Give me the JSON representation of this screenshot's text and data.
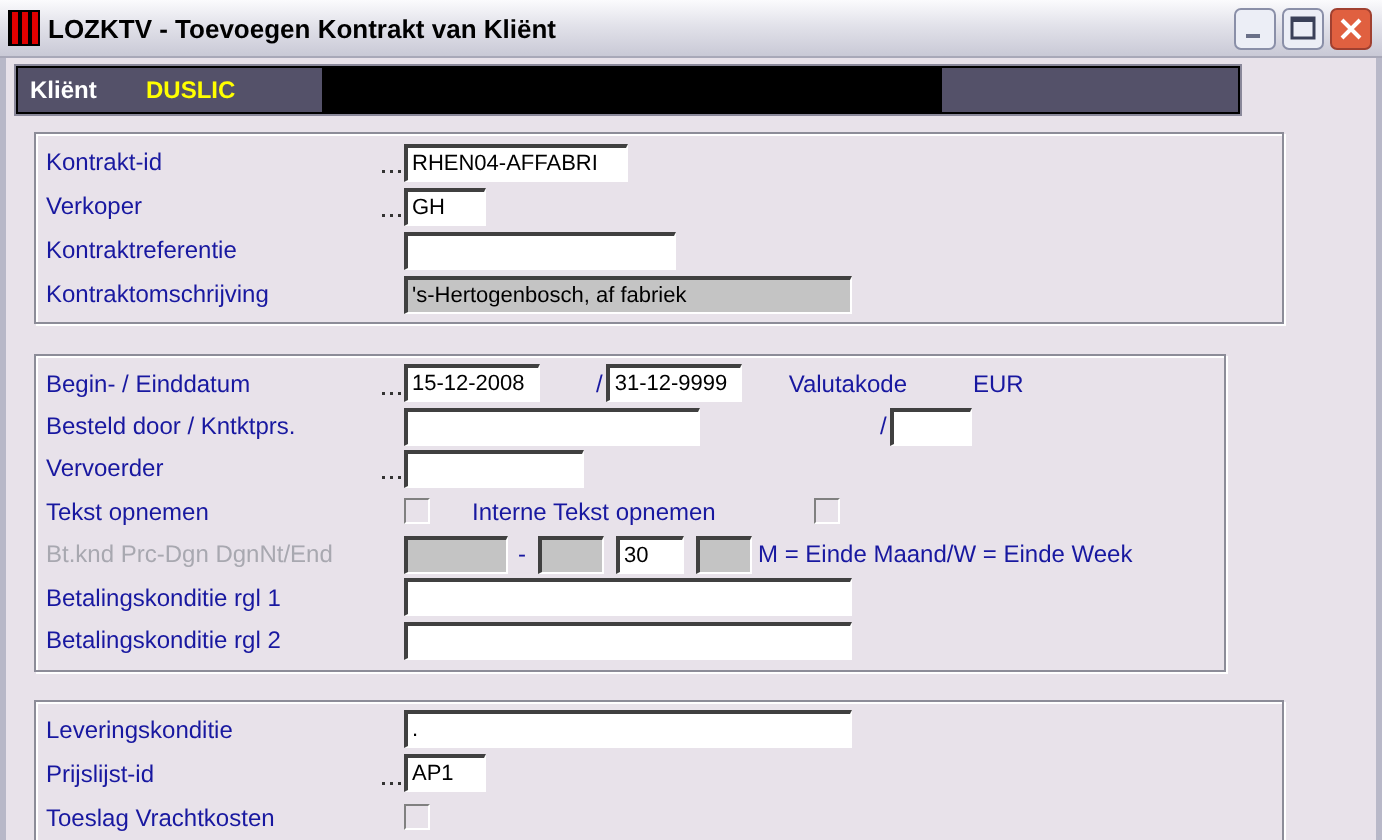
{
  "window": {
    "title": "LOZKTV - Toevoegen Kontrakt van Kliënt"
  },
  "header": {
    "label": "Kliënt",
    "value": "DUSLIC"
  },
  "groups": [
    {
      "rows": [
        {
          "label": "Kontrakt-id",
          "lookup": true,
          "disabled": false,
          "items": [
            {
              "kind": "field",
              "value": "RHEN04-AFFABRI",
              "disabled": false
            }
          ]
        },
        {
          "label": "Verkoper",
          "lookup": true,
          "disabled": false,
          "items": [
            {
              "kind": "field",
              "value": "GH",
              "disabled": false
            }
          ]
        },
        {
          "label": "Kontraktreferentie",
          "lookup": false,
          "disabled": false,
          "items": [
            {
              "kind": "field",
              "disabled": false
            }
          ]
        },
        {
          "label": "Kontraktomschrijving",
          "lookup": false,
          "disabled": false,
          "items": [
            {
              "kind": "field",
              "value": "'s-Hertogenbosch, af fabriek",
              "disabled": true
            }
          ]
        }
      ]
    },
    {
      "rows": [
        {
          "label": "Begin- / Einddatum",
          "lookup": true,
          "disabled": false,
          "items": [
            {
              "kind": "field",
              "value": "15-12-2008",
              "disabled": false
            },
            {
              "kind": "separator",
              "text": "/"
            },
            {
              "kind": "field",
              "value": "31-12-9999",
              "disabled": false
            },
            {
              "kind": "label",
              "text": "Valutakode"
            },
            {
              "kind": "label",
              "text": "EUR"
            }
          ]
        },
        {
          "label": "Besteld door / Kntktprs.",
          "lookup": false,
          "disabled": false,
          "items": [
            {
              "kind": "field",
              "disabled": false
            },
            {
              "kind": "separator",
              "text": "/"
            },
            {
              "kind": "field",
              "disabled": false
            }
          ]
        },
        {
          "label": "Vervoerder",
          "lookup": true,
          "disabled": false,
          "items": [
            {
              "kind": "field",
              "disabled": false
            }
          ]
        },
        {
          "label": "Tekst opnemen",
          "lookup": false,
          "disabled": false,
          "items": [
            {
              "kind": "checkbox",
              "checked": false
            },
            {
              "kind": "label",
              "text": "Interne Tekst opnemen"
            },
            {
              "kind": "checkbox",
              "checked": false
            }
          ]
        },
        {
          "label": "Bt.knd Prc-Dgn DgnNt/End",
          "lookup": false,
          "disabled": true,
          "items": [
            {
              "kind": "field",
              "disabled": true
            },
            {
              "kind": "separator",
              "text": "-"
            },
            {
              "kind": "field",
              "disabled": true
            },
            {
              "kind": "field",
              "value": "30",
              "disabled": false
            },
            {
              "kind": "field",
              "disabled": true
            },
            {
              "kind": "label",
              "text": "M = Einde Maand/W = Einde Week"
            }
          ]
        },
        {
          "label": "Betalingskonditie rgl 1",
          "lookup": false,
          "disabled": false,
          "items": [
            {
              "kind": "field",
              "disabled": false
            }
          ]
        },
        {
          "label": "Betalingskonditie rgl 2",
          "lookup": false,
          "disabled": false,
          "items": [
            {
              "kind": "field",
              "disabled": false
            }
          ]
        }
      ]
    },
    {
      "rows": [
        {
          "label": "Leveringskonditie",
          "lookup": false,
          "disabled": false,
          "items": [
            {
              "kind": "field",
              "value": ".",
              "disabled": false
            }
          ]
        },
        {
          "label": "Prijslijst-id",
          "lookup": true,
          "disabled": false,
          "items": [
            {
              "kind": "field",
              "value": "AP1",
              "disabled": false
            }
          ]
        },
        {
          "label": "Toeslag Vrachtkosten",
          "lookup": false,
          "disabled": false,
          "items": [
            {
              "kind": "checkbox",
              "checked": false
            }
          ]
        }
      ]
    }
  ]
}
